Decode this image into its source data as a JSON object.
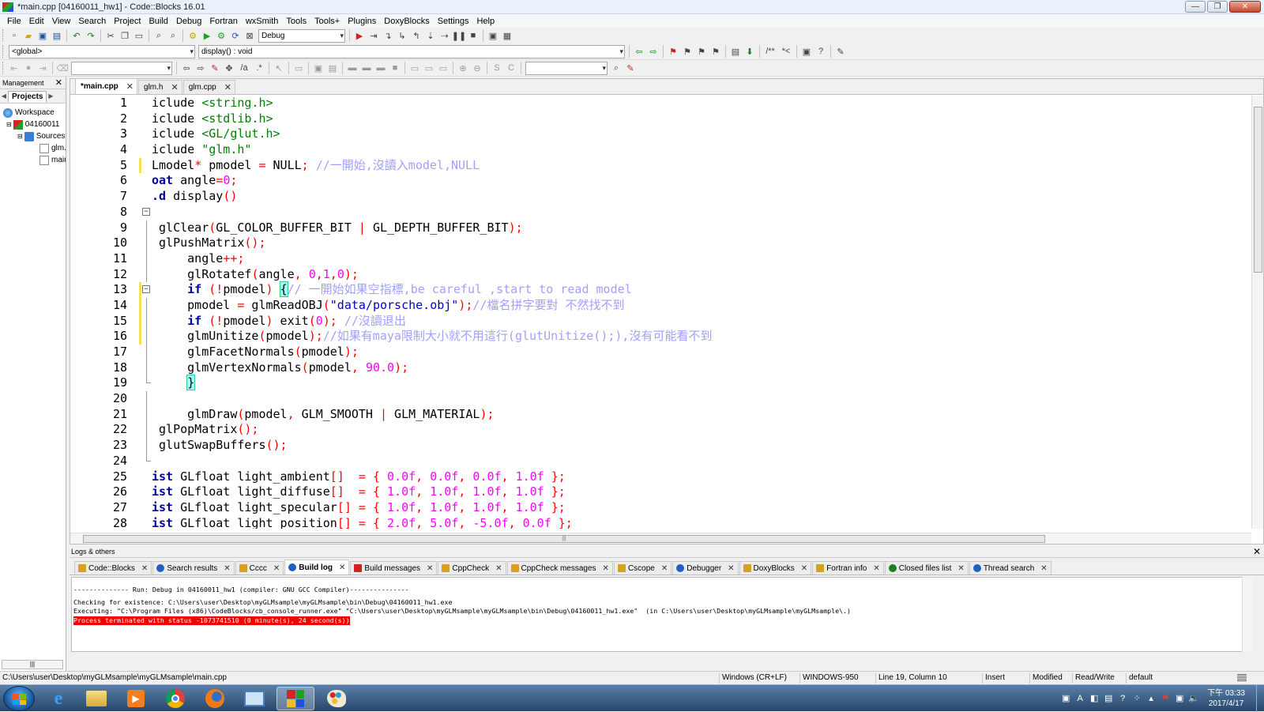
{
  "window": {
    "title": "*main.cpp [04160011_hw1] - Code::Blocks 16.01"
  },
  "menu": [
    "File",
    "Edit",
    "View",
    "Search",
    "Project",
    "Build",
    "Debug",
    "Fortran",
    "wxSmith",
    "Tools",
    "Tools+",
    "Plugins",
    "DoxyBlocks",
    "Settings",
    "Help"
  ],
  "toolbar": {
    "build_target": "Debug",
    "scope": "<global>",
    "function": "display() : void",
    "search": "",
    "find": ""
  },
  "management": {
    "title": "Management",
    "tab": "Projects",
    "tree": [
      "Workspace",
      "04160011",
      "Sources",
      "glm.cpp",
      "main.cpp"
    ]
  },
  "editor": {
    "tabs": [
      {
        "label": "*main.cpp",
        "active": true
      },
      {
        "label": "glm.h",
        "active": false
      },
      {
        "label": "glm.cpp",
        "active": false
      }
    ],
    "lines": [
      {
        "n": "1",
        "html": "<span class='kw'></span>iclude <span class='str'>&lt;string.h&gt;</span>"
      },
      {
        "n": "2",
        "html": "iclude <span class='str'>&lt;stdlib.h&gt;</span>"
      },
      {
        "n": "3",
        "html": "iclude <span class='str'>&lt;GL/glut.h&gt;</span>"
      },
      {
        "n": "4",
        "html": "iclude <span class='str'>\"glm.h\"</span>"
      },
      {
        "n": "5",
        "html": "Lmodel<span class='op'>*</span> pmodel <span class='op'>=</span> NULL<span class='op'>;</span> <span class='cm'>//一開始,沒讀入model,NULL</span>"
      },
      {
        "n": "6",
        "html": "<span class='kw'>oat</span> angle<span class='op'>=</span><span class='num'>0</span><span class='op'>;</span>"
      },
      {
        "n": "7",
        "html": "<span class='kw'>.d</span> display<span class='op'>()</span>"
      },
      {
        "n": "8",
        "html": ""
      },
      {
        "n": "9",
        "html": " glClear<span class='op'>(</span>GL_COLOR_BUFFER_BIT <span class='op'>|</span> GL_DEPTH_BUFFER_BIT<span class='op'>);</span>"
      },
      {
        "n": "10",
        "html": " glPushMatrix<span class='op'>();</span>"
      },
      {
        "n": "11",
        "html": "     angle<span class='op'>++;</span>"
      },
      {
        "n": "12",
        "html": "     glRotatef<span class='op'>(</span>angle<span class='op'>,</span> <span class='num'>0</span><span class='op'>,</span><span class='num'>1</span><span class='op'>,</span><span class='num'>0</span><span class='op'>);</span>"
      },
      {
        "n": "13",
        "html": "     <span class='kw'>if</span> <span class='op'>(!</span>pmodel<span class='op'>)</span> <span class='cur'>{</span><span class='cm'>// 一開始如果空指標,be careful ,start to read model</span>"
      },
      {
        "n": "14",
        "html": "     pmodel <span class='op'>=</span> glmReadOBJ<span class='op'>(</span><span class='str' style='color:#0000c0'>\"data/porsche.obj\"</span><span class='op'>);</span><span class='cm'>//檔名拼字要對 不然找不到</span>"
      },
      {
        "n": "15",
        "html": "     <span class='kw'>if</span> <span class='op'>(!</span>pmodel<span class='op'>)</span> exit<span class='op'>(</span><span class='num'>0</span><span class='op'>);</span> <span class='cm'>//沒讀退出</span>"
      },
      {
        "n": "16",
        "html": "     glmUnitize<span class='op'>(</span>pmodel<span class='op'>);</span><span class='cm'>//如果有maya限制大小就不用這行(glutUnitize();),沒有可能看不到</span>"
      },
      {
        "n": "17",
        "html": "     glmFacetNormals<span class='op'>(</span>pmodel<span class='op'>);</span>"
      },
      {
        "n": "18",
        "html": "     glmVertexNormals<span class='op'>(</span>pmodel<span class='op'>,</span> <span class='num'>90.0</span><span class='op'>);</span>"
      },
      {
        "n": "19",
        "html": "     <span class='cur'>}</span>"
      },
      {
        "n": "20",
        "html": ""
      },
      {
        "n": "21",
        "html": "     glmDraw<span class='op'>(</span>pmodel<span class='op'>,</span> GLM_SMOOTH <span class='op'>|</span> GLM_MATERIAL<span class='op'>);</span>"
      },
      {
        "n": "22",
        "html": " glPopMatrix<span class='op'>();</span>"
      },
      {
        "n": "23",
        "html": " glutSwapBuffers<span class='op'>();</span>"
      },
      {
        "n": "24",
        "html": ""
      },
      {
        "n": "25",
        "html": "<span class='kw'>ist</span> GLfloat light_ambient<span class='op'>[]</span>  <span class='op'>=</span> <span class='op'>{</span> <span class='num'>0.0f</span><span class='op'>,</span> <span class='num'>0.0f</span><span class='op'>,</span> <span class='num'>0.0f</span><span class='op'>,</span> <span class='num'>1.0f</span> <span class='op'>};</span>"
      },
      {
        "n": "26",
        "html": "<span class='kw'>ist</span> GLfloat light_diffuse<span class='op'>[]</span>  <span class='op'>=</span> <span class='op'>{</span> <span class='num'>1.0f</span><span class='op'>,</span> <span class='num'>1.0f</span><span class='op'>,</span> <span class='num'>1.0f</span><span class='op'>,</span> <span class='num'>1.0f</span> <span class='op'>};</span>"
      },
      {
        "n": "27",
        "html": "<span class='kw'>ist</span> GLfloat light_specular<span class='op'>[]</span> <span class='op'>=</span> <span class='op'>{</span> <span class='num'>1.0f</span><span class='op'>,</span> <span class='num'>1.0f</span><span class='op'>,</span> <span class='num'>1.0f</span><span class='op'>,</span> <span class='num'>1.0f</span> <span class='op'>};</span>"
      },
      {
        "n": "28",
        "html": "<span class='kw'>ist</span> GLfloat light_position<span class='op'>[]</span> <span class='op'>=</span> <span class='op'>{</span> <span class='num'>2.0f</span><span class='op'>,</span> <span class='num'>5.0f</span><span class='op'>,</span> <span class='num'>-5.0f</span><span class='op'>,</span> <span class='num'>0.0f</span> <span class='op'>};</span>"
      }
    ]
  },
  "logs": {
    "title": "Logs & others",
    "tabs": [
      {
        "label": "Code::Blocks",
        "icon": "page-icon",
        "active": false
      },
      {
        "label": "Search results",
        "icon": "search-icon",
        "active": false
      },
      {
        "label": "Cccc",
        "icon": "page-icon",
        "active": false
      },
      {
        "label": "Build log",
        "icon": "gear-icon",
        "active": true
      },
      {
        "label": "Build messages",
        "icon": "pin-icon",
        "active": false
      },
      {
        "label": "CppCheck",
        "icon": "page-icon",
        "active": false
      },
      {
        "label": "CppCheck messages",
        "icon": "page-icon",
        "active": false
      },
      {
        "label": "Cscope",
        "icon": "page-icon",
        "active": false
      },
      {
        "label": "Debugger",
        "icon": "gear-icon",
        "active": false
      },
      {
        "label": "DoxyBlocks",
        "icon": "page-icon",
        "active": false
      },
      {
        "label": "Fortran info",
        "icon": "page-icon",
        "active": false
      },
      {
        "label": "Closed files list",
        "icon": "refresh-icon",
        "active": false
      },
      {
        "label": "Thread search",
        "icon": "search-icon",
        "active": false
      }
    ],
    "lines": [
      "-------------- Run: Debug in 04160011_hw1 (compiler: GNU GCC Compiler)---------------",
      "Checking for existence: C:\\Users\\user\\Desktop\\myGLMsample\\myGLMsample\\bin\\Debug\\04160011_hw1.exe",
      "Executing: \"C:\\Program Files (x86)\\CodeBlocks/cb_console_runner.exe\" \"C:\\Users\\user\\Desktop\\myGLMsample\\myGLMsample\\bin\\Debug\\04160011_hw1.exe\"  (in C:\\Users\\user\\Desktop\\myGLMsample\\myGLMsample\\.)"
    ],
    "error": "Process terminated with status -1073741510 (0 minute(s), 24 second(s))"
  },
  "status": {
    "path": "C:\\Users\\user\\Desktop\\myGLMsample\\myGLMsample\\main.cpp",
    "eol": "Windows (CR+LF)",
    "encoding": "WINDOWS-950",
    "position": "Line 19, Column 10",
    "mode": "Insert",
    "modified": "Modified",
    "access": "Read/Write",
    "profile": "default"
  },
  "taskbar": {
    "time": "下午 03:33",
    "date": "2017/4/17",
    "lang": "A"
  }
}
